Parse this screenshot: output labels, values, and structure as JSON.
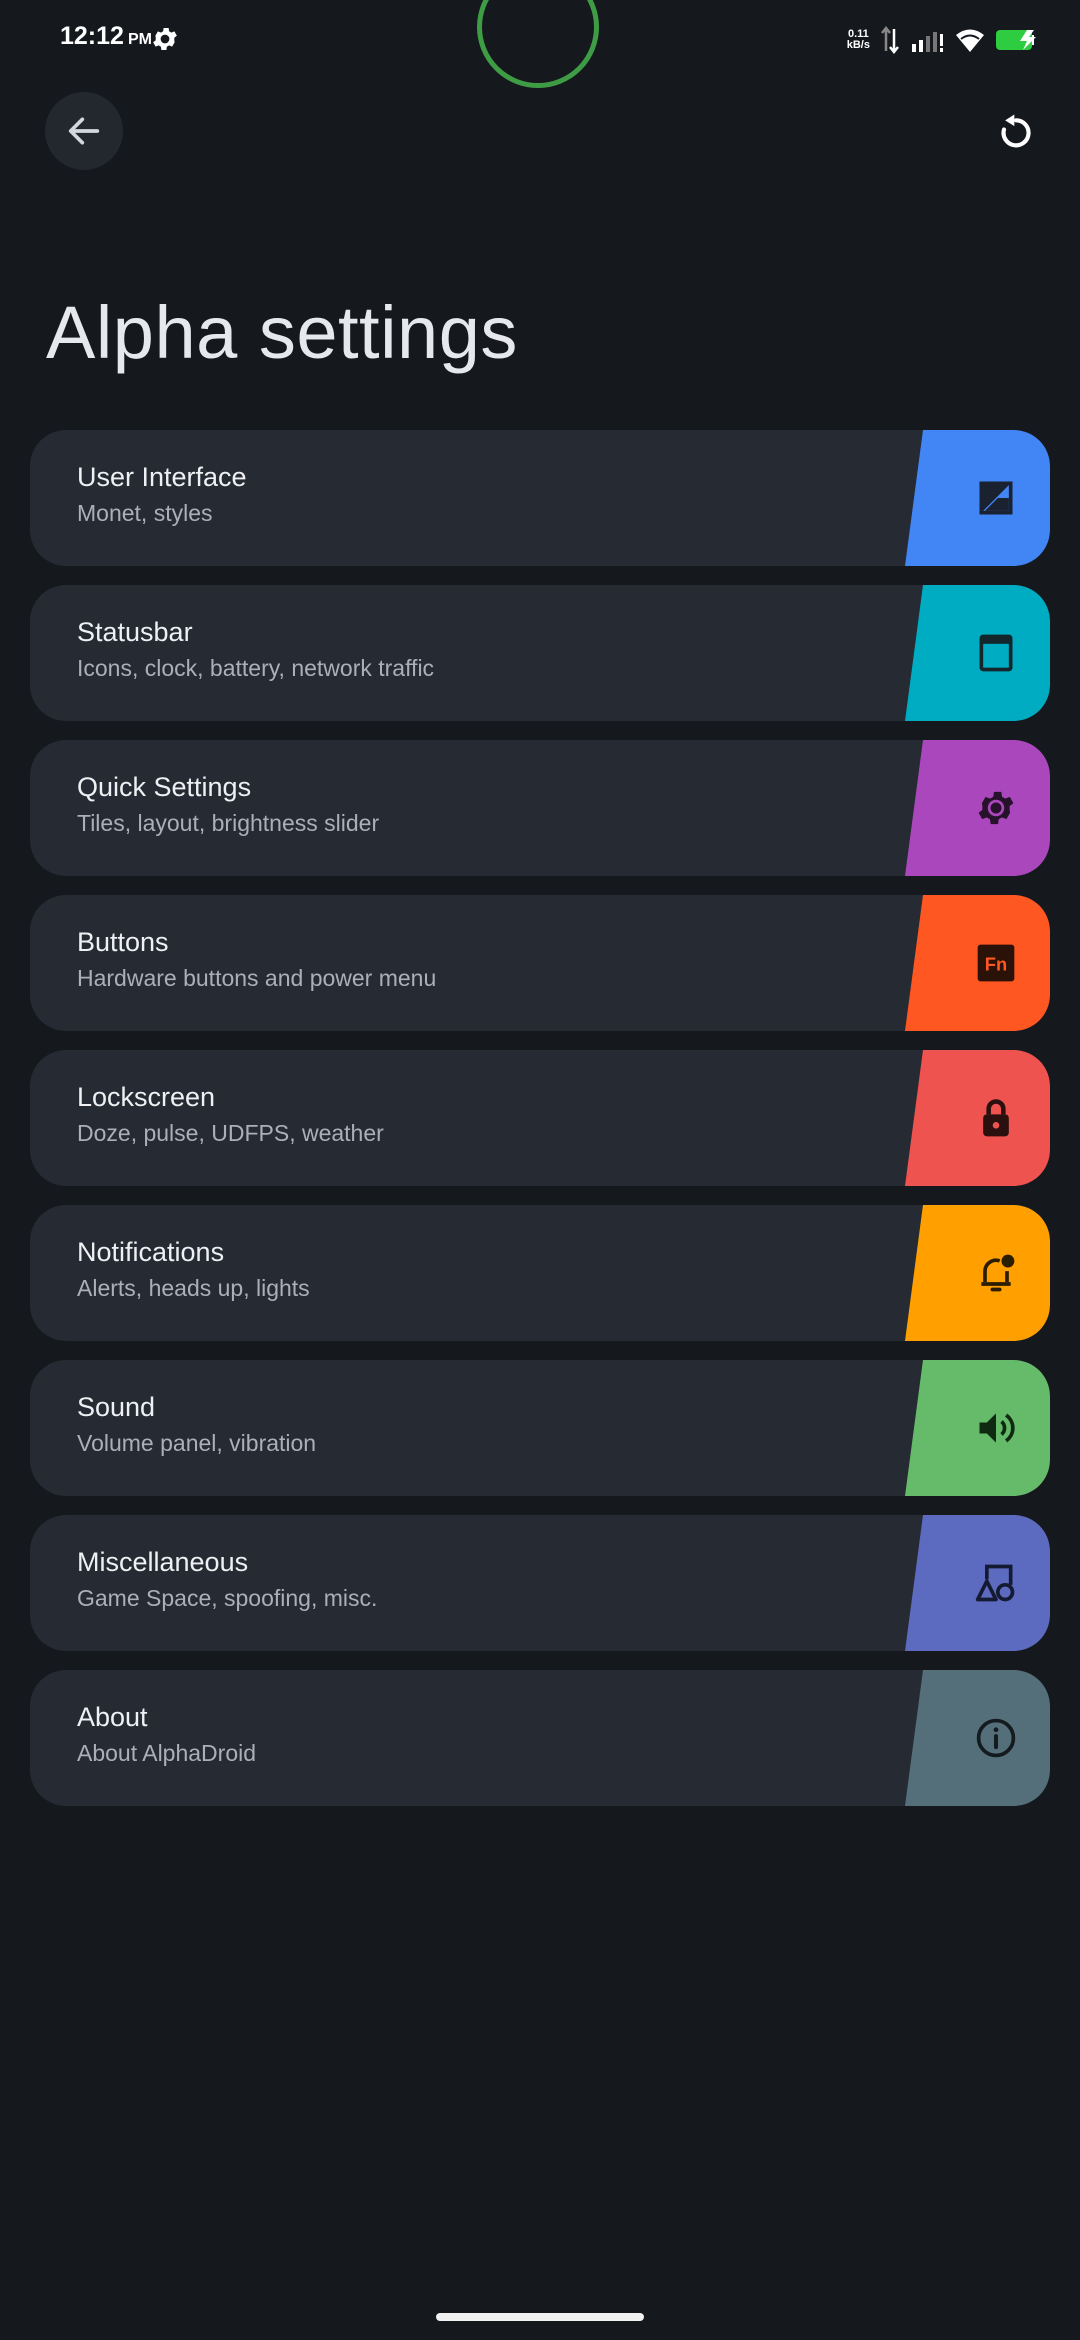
{
  "status_bar": {
    "time": "12:12",
    "ampm": "PM",
    "net_speed_value": "0.11",
    "net_speed_unit": "kB/s",
    "battery_color": "#2ecc40"
  },
  "header": {
    "back_icon": "arrow-left-icon",
    "reset_icon": "reset-icon",
    "title": "Alpha settings"
  },
  "items": [
    {
      "title": "User Interface",
      "subtitle": "Monet, styles",
      "color": "#4285f4",
      "icon": "theme-icon"
    },
    {
      "title": "Statusbar",
      "subtitle": "Icons, clock, battery, network traffic",
      "color": "#00acc1",
      "icon": "statusbar-icon"
    },
    {
      "title": "Quick Settings",
      "subtitle": "Tiles, layout, brightness slider",
      "color": "#ab47bc",
      "icon": "gear-icon"
    },
    {
      "title": "Buttons",
      "subtitle": "Hardware buttons and power menu",
      "color": "#ff5722",
      "icon": "fn-key-icon",
      "icon_text": "Fn"
    },
    {
      "title": "Lockscreen",
      "subtitle": "Doze, pulse, UDFPS, weather",
      "color": "#ef5350",
      "icon": "lock-icon"
    },
    {
      "title": "Notifications",
      "subtitle": "Alerts, heads up, lights",
      "color": "#ffa000",
      "icon": "bell-icon"
    },
    {
      "title": "Sound",
      "subtitle": "Volume panel, vibration",
      "color": "#66bb6a",
      "icon": "speaker-icon"
    },
    {
      "title": "Miscellaneous",
      "subtitle": "Game Space, spoofing, misc.",
      "color": "#5c6bc0",
      "icon": "shapes-icon"
    },
    {
      "title": "About",
      "subtitle": "About AlphaDroid",
      "color": "#546e7a",
      "icon": "info-icon"
    }
  ]
}
